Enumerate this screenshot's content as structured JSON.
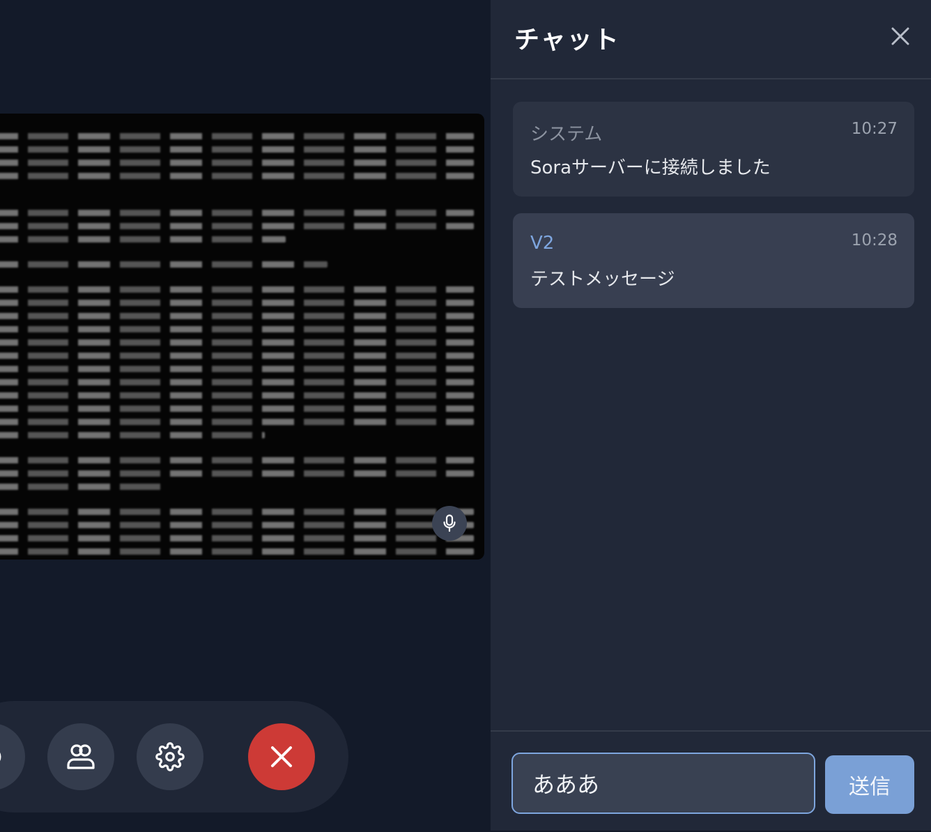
{
  "chat": {
    "title": "チャット",
    "messages": [
      {
        "sender": "システム",
        "time": "10:27",
        "text": "Soraサーバーに接続しました"
      },
      {
        "sender": "V2",
        "time": "10:28",
        "text": "テストメッセージ"
      }
    ],
    "input_value": "あああ",
    "send_label": "送信"
  },
  "icons": {
    "close": "close-icon",
    "mic": "microphone-icon",
    "participants": "people-icon",
    "settings": "gear-icon",
    "end_call": "x-icon"
  },
  "colors": {
    "accent": "#7ea6df",
    "end_call": "#cd3a36",
    "panel": "#212838",
    "stage": "#131a29"
  }
}
